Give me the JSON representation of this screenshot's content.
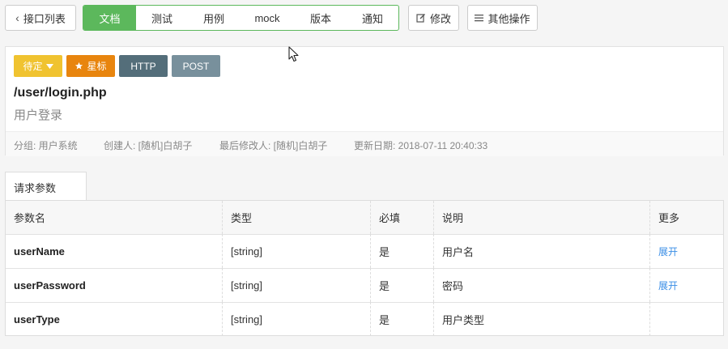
{
  "toolbar": {
    "back_label": "接口列表",
    "tabs": [
      "文档",
      "测试",
      "用例",
      "mock",
      "版本",
      "通知"
    ],
    "edit_label": "修改",
    "more_label": "其他操作"
  },
  "api": {
    "badges": {
      "status": "待定",
      "star": "星标",
      "protocol": "HTTP",
      "method": "POST"
    },
    "path": "/user/login.php",
    "name": "用户登录",
    "meta": {
      "group": "分组: 用户系统",
      "creator": "创建人: [随机]白胡子",
      "modifier": "最后修改人: [随机]白胡子",
      "updated": "更新日期: 2018-07-11 20:40:33"
    }
  },
  "params": {
    "tab_label": "请求参数",
    "headers": [
      "参数名",
      "类型",
      "必填",
      "说明",
      "更多"
    ],
    "rows": [
      {
        "name": "userName",
        "type": "[string]",
        "required": "是",
        "desc": "用户名",
        "more": "展开"
      },
      {
        "name": "userPassword",
        "type": "[string]",
        "required": "是",
        "desc": "密码",
        "more": "展开"
      },
      {
        "name": "userType",
        "type": "[string]",
        "required": "是",
        "desc": "用户类型",
        "more": ""
      }
    ]
  },
  "colors": {
    "accent_green": "#5cb85c",
    "badge_yellow": "#f0c330",
    "badge_orange": "#e8850e",
    "badge_dark": "#546e7a",
    "badge_gray": "#78909c",
    "link_blue": "#3a8ee6"
  }
}
